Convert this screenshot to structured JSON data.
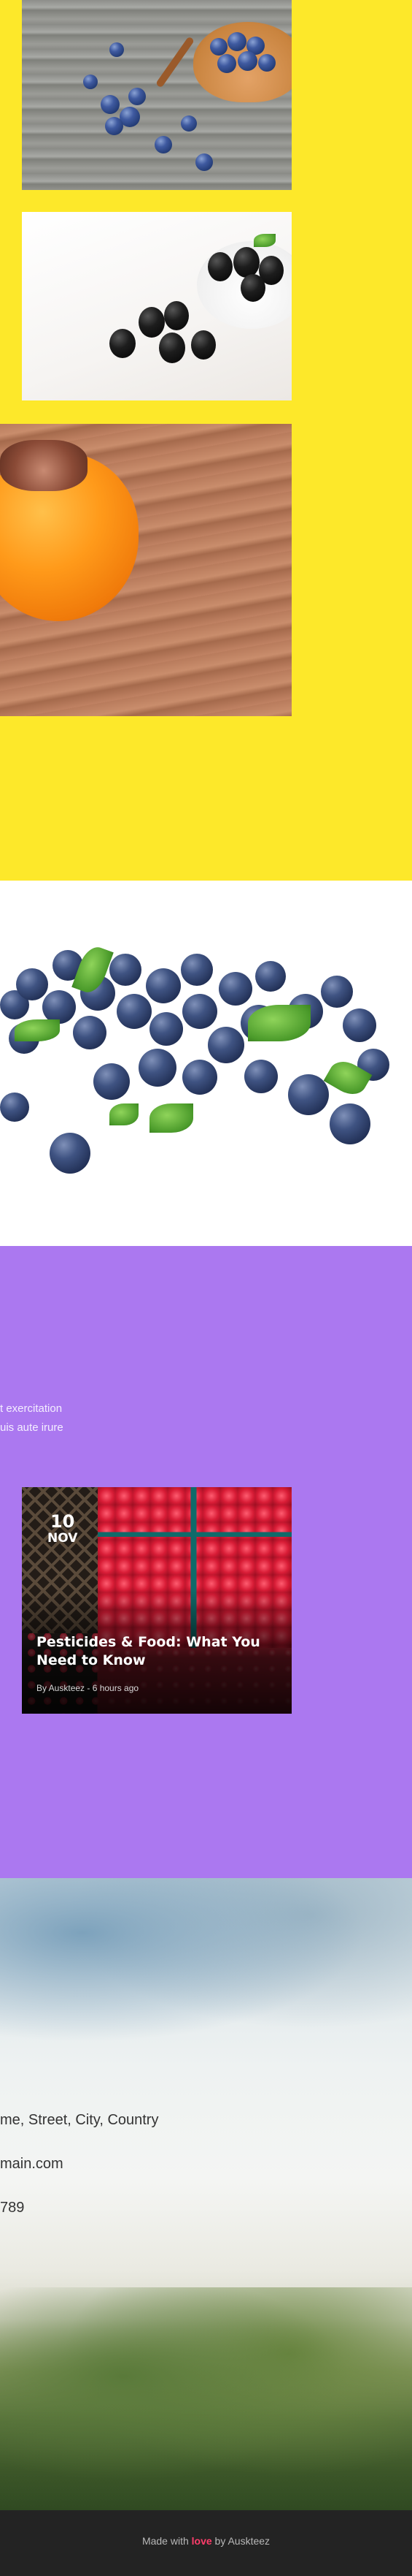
{
  "blog_card": {
    "day": "10",
    "month": "NOV",
    "title": "Pesticides & Food: What You Need to Know",
    "meta": "By Auskteez - 6 hours ago"
  },
  "intro": {
    "line1": "t exercitation",
    "line2": "uis aute irure"
  },
  "contact": {
    "address": "me, Street, City, Country",
    "email": "main.com",
    "phone": "789"
  },
  "footer": {
    "prefix": "Made with ",
    "love": "love",
    "suffix": " by Auskteez"
  }
}
